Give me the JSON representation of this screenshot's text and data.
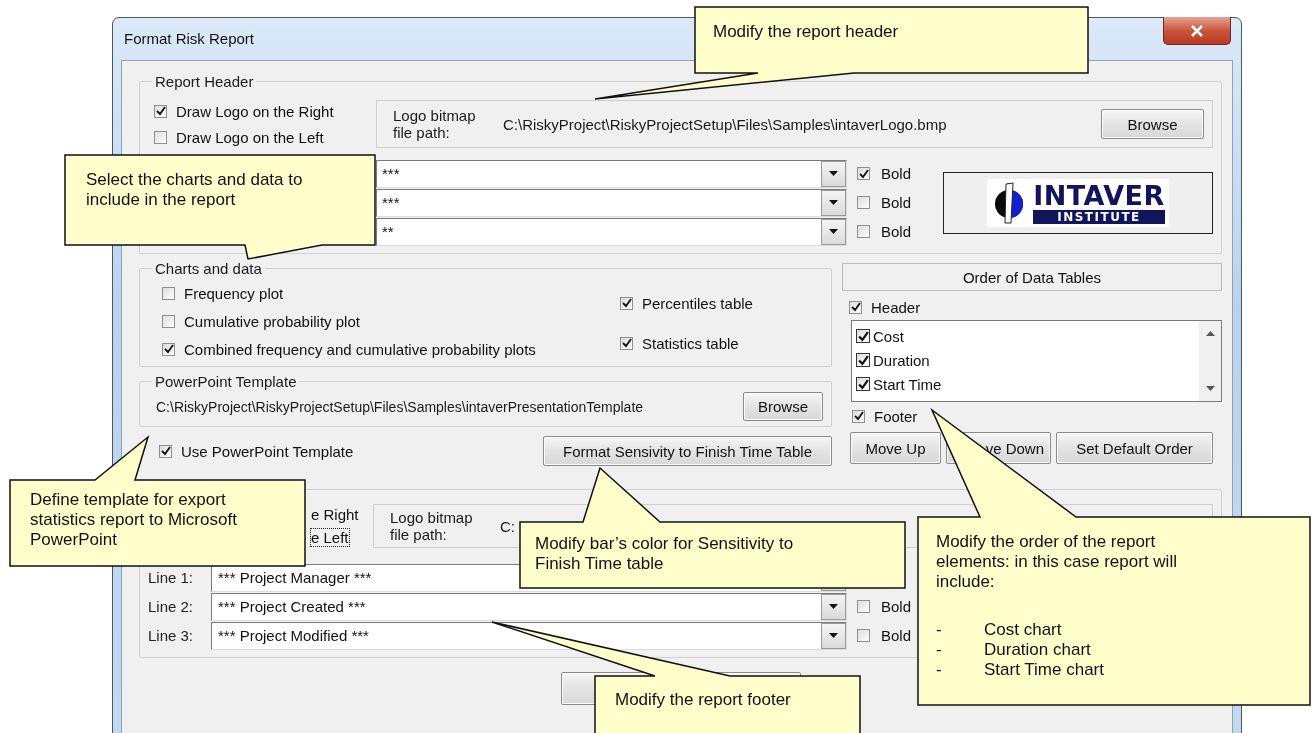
{
  "window": {
    "title": "Format Risk Report"
  },
  "report_header": {
    "legend": "Report Header",
    "logo_options": [
      {
        "label": "Draw Logo on the Right",
        "checked": true
      },
      {
        "label": "Draw Logo on the Left",
        "checked": false
      }
    ],
    "logo_path_label": [
      "Logo bitmap",
      "file path:"
    ],
    "logo_path": "C:\\RiskyProject\\RiskyProjectSetup\\Files\\Samples\\intaverLogo.bmp",
    "browse": "Browse",
    "lines": [
      {
        "value": "***",
        "bold_label": "Bold",
        "bold": true
      },
      {
        "value": "***",
        "bold_label": "Bold",
        "bold": false
      },
      {
        "value": "**",
        "bold_label": "Bold",
        "bold": false
      }
    ],
    "logo": {
      "title": "INTAVER",
      "subtitle": "INSTITUTE"
    }
  },
  "charts_and_data": {
    "legend": "Charts and data",
    "plots": [
      {
        "label": "Frequency plot",
        "checked": false
      },
      {
        "label": "Cumulative probability plot",
        "checked": false
      },
      {
        "label": "Combined frequency and cumulative probability plots",
        "checked": true
      }
    ],
    "tables": [
      {
        "label": "Percentiles table",
        "checked": true
      },
      {
        "label": "Statistics table",
        "checked": true
      }
    ]
  },
  "powerpoint_template": {
    "legend": "PowerPoint Template",
    "path": "C:\\RiskyProject\\RiskyProjectSetup\\Files\\Samples\\intaverPresentationTemplate",
    "browse": "Browse",
    "use_template": {
      "label": "Use PowerPoint Template",
      "checked": true
    },
    "format_button": "Format Sensivity to Finish Time Table"
  },
  "order_of_data_tables": {
    "title": "Order of Data Tables",
    "header": {
      "label": "Header",
      "checked": true
    },
    "items": [
      {
        "label": "Cost",
        "checked": true
      },
      {
        "label": "Duration",
        "checked": true
      },
      {
        "label": "Start Time",
        "checked": true
      }
    ],
    "footer": {
      "label": "Footer",
      "checked": true
    },
    "buttons": [
      "Move Up",
      "ve Down",
      "Set Default Order"
    ]
  },
  "report_footer": {
    "logo_options": [
      {
        "label": "e Right",
        "focused": false
      },
      {
        "label": "e Left",
        "focused": true
      }
    ],
    "logo_path_label": [
      "Logo bitmap",
      "file path:"
    ],
    "logo_path": "C:",
    "lines": [
      {
        "label": "Line 1:",
        "value": "*** Project Manager ***"
      },
      {
        "label": "Line 2:",
        "value": "*** Project Created ***",
        "bold_label": "Bold",
        "bold": false
      },
      {
        "label": "Line 3:",
        "value": "*** Project Modified ***",
        "bold_label": "Bold",
        "bold": false
      }
    ]
  },
  "callouts": [
    {
      "text": "Modify the report header"
    },
    {
      "text": "Select the charts and data to include in the report"
    },
    {
      "text": "Define template for export statistics report to Microsoft PowerPoint"
    },
    {
      "text": "Modify bar’s color for Sensitivity to Finish Time table"
    },
    {
      "text": "Modify the report footer"
    },
    {
      "text": "Modify the order of the report elements: in this case report will include:",
      "items": [
        {
          "bullet": "-",
          "text": "Cost chart"
        },
        {
          "bullet": "-",
          "text": "Duration chart"
        },
        {
          "bullet": "-",
          "text": "Start Time chart"
        }
      ]
    }
  ]
}
